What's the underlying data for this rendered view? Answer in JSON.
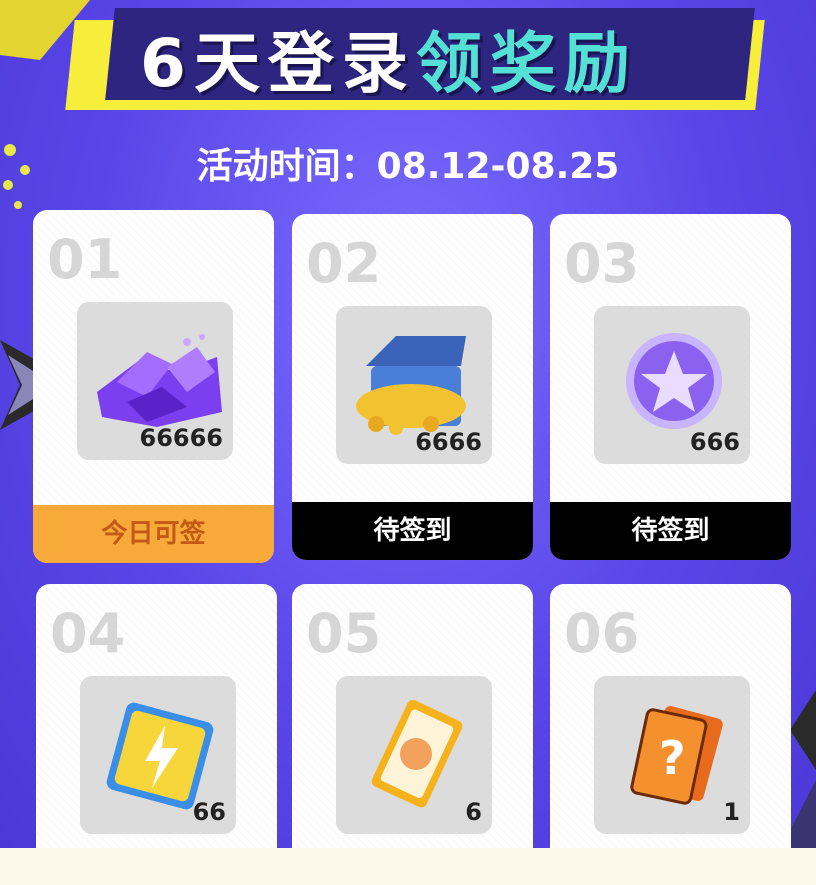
{
  "title": {
    "day": "6",
    "part1": "天登录",
    "part2": "领奖励"
  },
  "subtitle": "活动时间：08.12-08.25",
  "cards": [
    {
      "num": "01",
      "qty": "66666",
      "status": "今日可签",
      "icon": "purple-crystals-icon"
    },
    {
      "num": "02",
      "qty": "6666",
      "status": "待签到",
      "icon": "treasure-chest-icon"
    },
    {
      "num": "03",
      "qty": "666",
      "status": "待签到",
      "icon": "star-coin-icon"
    },
    {
      "num": "04",
      "qty": "66",
      "icon": "lightning-ticket-icon"
    },
    {
      "num": "05",
      "qty": "6",
      "icon": "orange-card-icon"
    },
    {
      "num": "06",
      "qty": "1",
      "icon": "mystery-card-icon"
    }
  ],
  "colors": {
    "background": "#5a46e8",
    "accent_today": "#f7a93a",
    "title_teal": "#55e0d6"
  }
}
